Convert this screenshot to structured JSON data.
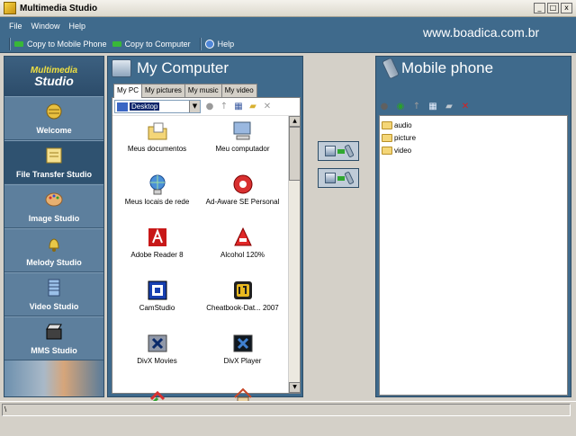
{
  "window": {
    "title": "Multimedia Studio",
    "min": "_",
    "max": "□",
    "close": "x"
  },
  "menu": [
    "File",
    "Window",
    "Help"
  ],
  "toolbar": {
    "copy_mobile": "Copy to Mobile Phone",
    "copy_computer": "Copy to Computer",
    "help": "Help"
  },
  "watermark": "www.boadica.com.br",
  "brand": {
    "line1": "Multimedia",
    "line2": "Studio"
  },
  "nav": [
    {
      "label": "Welcome",
      "icon": "globe-icon"
    },
    {
      "label": "File Transfer Studio",
      "icon": "file-transfer-icon",
      "active": true
    },
    {
      "label": "Image Studio",
      "icon": "palette-icon"
    },
    {
      "label": "Melody Studio",
      "icon": "bell-icon"
    },
    {
      "label": "Video Studio",
      "icon": "film-icon"
    },
    {
      "label": "MMS Studio",
      "icon": "clapper-icon"
    }
  ],
  "computer": {
    "title": "My Computer",
    "tabs": [
      "My PC",
      "My pictures",
      "My music",
      "My video"
    ],
    "location": "Desktop",
    "files": [
      {
        "label": "Meus documentos",
        "icon": "folder-docs-icon"
      },
      {
        "label": "Meu computador",
        "icon": "computer-icon"
      },
      {
        "label": "Meus locais de rede",
        "icon": "network-icon"
      },
      {
        "label": "Ad-Aware SE Personal",
        "icon": "ad-aware-icon"
      },
      {
        "label": "Adobe Reader 8",
        "icon": "adobe-reader-icon"
      },
      {
        "label": "Alcohol 120%",
        "icon": "alcohol-icon"
      },
      {
        "label": "CamStudio",
        "icon": "camstudio-icon"
      },
      {
        "label": "Cheatbook-Dat... 2007",
        "icon": "cheatbook-icon"
      },
      {
        "label": "DivX Movies",
        "icon": "divx-movies-icon"
      },
      {
        "label": "DivX Player",
        "icon": "divx-player-icon"
      },
      {
        "label": "",
        "icon": "app-icon"
      },
      {
        "label": "",
        "icon": "house-icon"
      }
    ]
  },
  "mobile": {
    "title": "Mobile phone",
    "folders": [
      "audio",
      "picture",
      "video"
    ]
  },
  "status": "\\"
}
